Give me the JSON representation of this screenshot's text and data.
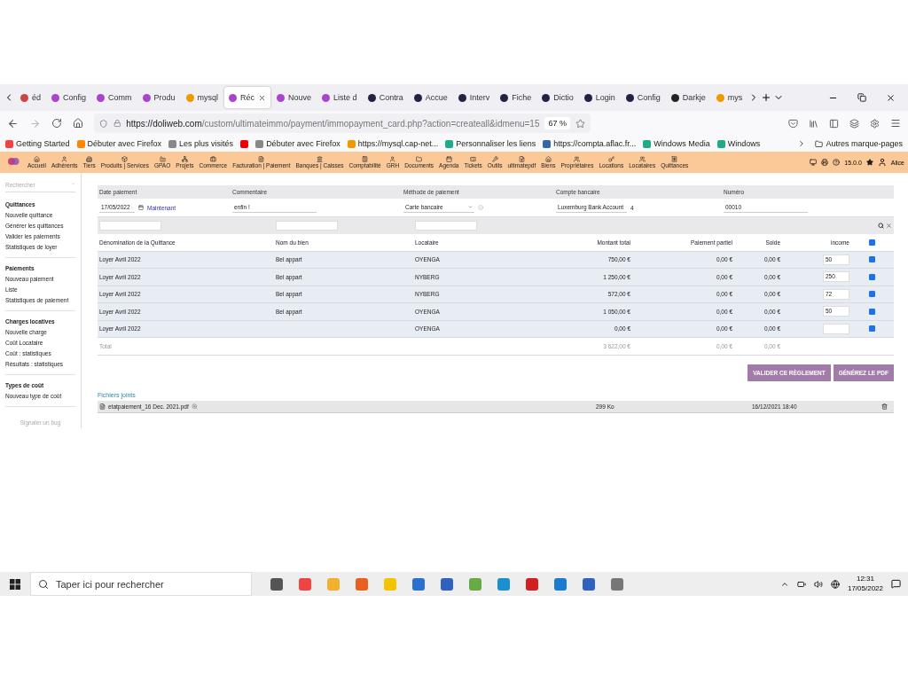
{
  "browser": {
    "tabs": [
      {
        "label": "éd",
        "selected": false
      },
      {
        "label": "Config",
        "selected": false
      },
      {
        "label": "Comm",
        "selected": false
      },
      {
        "label": "Produ",
        "selected": false
      },
      {
        "label": "mysql",
        "selected": false
      },
      {
        "label": "Réc",
        "selected": true
      },
      {
        "label": "Nouve",
        "selected": false
      },
      {
        "label": "Liste d",
        "selected": false
      },
      {
        "label": "Contra",
        "selected": false
      },
      {
        "label": "Accue",
        "selected": false
      },
      {
        "label": "Interv",
        "selected": false
      },
      {
        "label": "Fiche",
        "selected": false
      },
      {
        "label": "Dictio",
        "selected": false
      },
      {
        "label": "Login",
        "selected": false
      },
      {
        "label": "Config",
        "selected": false
      },
      {
        "label": "Darkje",
        "selected": false
      },
      {
        "label": "mys",
        "selected": false
      }
    ],
    "url_host": "https://doliweb.com",
    "url_path": "/custom/ultimateimmo/payment/immopayment_card.php?action=createall&idmenu=15",
    "zoom": "67 %",
    "bookmarks": [
      "Getting Started",
      "Débuter avec Firefox",
      "Les plus visités",
      "Débuter avec Firefox",
      "https://mysql.cap-net...",
      "Personnaliser les liens",
      "https://compta.aflac.fr...",
      "Windows Media",
      "Windows"
    ],
    "more_bookmarks": "Autres marque-pages"
  },
  "top_menu": {
    "items": [
      "Accueil",
      "Adhérents",
      "Tiers",
      "Produits | Services",
      "GPAO",
      "Projets",
      "Commerce",
      "Facturation | Paiement",
      "Banques | Caisses",
      "Comptabilité",
      "GRH",
      "Documents",
      "Agenda",
      "Tickets",
      "Outils",
      "ultimatepdf",
      "Biens",
      "Propriétaires",
      "Locations",
      "Locataires",
      "Quittances"
    ],
    "version": "15.0.0",
    "user": "Alice"
  },
  "sidebar": {
    "search_placeholder": "Rechercher",
    "sections": [
      {
        "title": "Quittances",
        "items": [
          "Nouvelle quittance",
          "Générer les quittances",
          "Valider les paiements",
          "Statistiques de loyer"
        ]
      },
      {
        "title": "Paiements",
        "items": [
          "Nouveau paiement",
          "Liste",
          "Statistiques de paiement"
        ]
      },
      {
        "title": "Charges locatives",
        "items": [
          "Nouvelle charge",
          "Coût Locataire",
          "Coût : statistiques",
          "Résultats : statistiques"
        ]
      },
      {
        "title": "Types de coût",
        "items": [
          "Nouveau type de coût"
        ]
      }
    ],
    "bug_link": "Signaler un bug"
  },
  "payment_form": {
    "fields": [
      {
        "kind": "date",
        "label": "Date paiement",
        "value": "17/05/2022",
        "extra": "Maintenant"
      },
      {
        "kind": "text",
        "label": "Commentaire",
        "value": "enfin !"
      },
      {
        "kind": "select",
        "label": "Méthode de paiement",
        "value": "Carte bancaire"
      },
      {
        "kind": "select",
        "label": "Compte bancaire",
        "value": "Luxemburg Bank Account",
        "extra": "4"
      },
      {
        "kind": "text",
        "label": "Numéro",
        "value": "00010"
      }
    ]
  },
  "table": {
    "columns": [
      "Dénomination de la Quittance",
      "Nom du bien",
      "Locataire",
      "Montant total",
      "Paiement partiel",
      "Solde",
      "income"
    ],
    "select_all_checked": true,
    "rows": [
      {
        "cells": [
          "Loyer Avril 2022",
          "Bel appart",
          "OYENGA",
          "750,00 €",
          "0,00 €",
          "0,00 €"
        ],
        "income": "50",
        "checked": true
      },
      {
        "cells": [
          "Loyer Avril 2022",
          "Bel appart",
          "NYBERG",
          "1 250,00 €",
          "0,00 €",
          "0,00 €"
        ],
        "income": "250",
        "checked": true
      },
      {
        "cells": [
          "Loyer Avril 2022",
          "Bel appart",
          "NYBERG",
          "572,00 €",
          "0,00 €",
          "0,00 €"
        ],
        "income": "72",
        "checked": true
      },
      {
        "cells": [
          "Loyer Avril 2022",
          "Bel appart",
          "OYENGA",
          "1 050,00 €",
          "0,00 €",
          "0,00 €"
        ],
        "income": "50",
        "checked": true
      },
      {
        "cells": [
          "Loyer Avril 2022",
          null,
          "OYENGA",
          "0,00 €",
          "0,00 €",
          "0,00 €"
        ],
        "income": null,
        "checked": true
      }
    ],
    "total": {
      "label": "Total",
      "values": [
        "3 622,00 €",
        "0,00 €",
        "0,00 €"
      ]
    }
  },
  "buttons": [
    "VALIDER CE RÈGLEMENT",
    "GÉNÉREZ LE PDF"
  ],
  "attachments": {
    "title": "Fichiers joints",
    "files": [
      {
        "name": "etatpaiement_16 Dec. 2021.pdf",
        "size": "299 Ko",
        "date": "16/12/2021 18:40"
      }
    ]
  },
  "taskbar": {
    "search_placeholder": "Taper ici pour rechercher",
    "time": "12:31",
    "date": "17/05/2022"
  }
}
